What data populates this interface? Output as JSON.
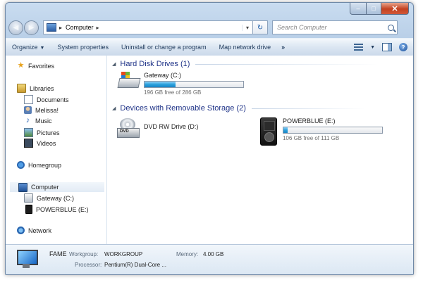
{
  "window": {
    "caption_min": "–",
    "caption_max": "□",
    "caption_close": "✕"
  },
  "navbar": {
    "back_glyph": "◀",
    "forward_glyph": "▶",
    "address_sep": "▸",
    "address_text": "Computer",
    "address_trail": "▸",
    "address_dropdown": "▾",
    "refresh_glyph": "↻",
    "search_placeholder": "Search Computer"
  },
  "toolbar": {
    "organize": "Organize",
    "organize_caret": "▼",
    "items": [
      "System properties",
      "Uninstall or change a program",
      "Map network drive"
    ],
    "more": "»",
    "help": "?",
    "views_caret": "▼"
  },
  "nav_pane": {
    "favorites": "Favorites",
    "libraries": "Libraries",
    "library_items": [
      "Documents",
      "Melissa!",
      "Music",
      "Pictures",
      "Videos"
    ],
    "homegroup": "Homegroup",
    "computer": "Computer",
    "computer_items": [
      "Gateway (C:)",
      "POWERBLUE (E:)"
    ],
    "network": "Network",
    "star_glyph": "★",
    "music_glyph": "♪"
  },
  "content": {
    "group_hdd": "Hard Disk Drives (1)",
    "group_removable": "Devices with Removable Storage (2)",
    "group_tri": "◢",
    "drives": {
      "c": {
        "name": "Gateway (C:)",
        "free": "196 GB free of 286 GB",
        "used_fraction": 0.315
      },
      "dvd": {
        "name": "DVD RW Drive (D:)",
        "badge": "DVD"
      },
      "e": {
        "name": "POWERBLUE (E:)",
        "free": "106 GB free of 111 GB",
        "used_fraction": 0.045
      }
    }
  },
  "details": {
    "computer_name": "FAME",
    "workgroup_label": "Workgroup:",
    "workgroup_value": "WORKGROUP",
    "memory_label": "Memory:",
    "memory_value": "4.00 GB",
    "processor_label": "Processor:",
    "processor_value": "Pentium(R) Dual-Core ..."
  },
  "colors": {
    "accent": "#1e3287",
    "progress": "#2aa0dd"
  }
}
